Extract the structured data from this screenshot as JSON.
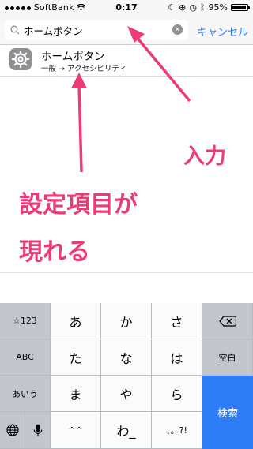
{
  "status_bar": {
    "carrier": "SoftBank",
    "time": "0:17",
    "battery_label": "95%",
    "battery_level": 0.95
  },
  "search": {
    "query": "ホームボタン",
    "cancel_label": "キャンセル"
  },
  "result": {
    "title": "ホームボタン",
    "path": "一般 → アクセシビリティ",
    "icon": "gear-icon"
  },
  "annotations": {
    "input_label": "入力",
    "appear_line1": "設定項目が",
    "appear_line2": "現れる",
    "color": "#ee3b76"
  },
  "keyboard": {
    "keys": {
      "numbers": "☆123",
      "abc": "ABC",
      "aiu": "あいう",
      "a": "あ",
      "ka": "か",
      "sa": "さ",
      "ta": "た",
      "na": "な",
      "ha": "は",
      "ma": "ま",
      "ya": "や",
      "ra": "ら",
      "dakuten": "^^",
      "wa": "わ_",
      "punct": "、。?!",
      "space": "空白",
      "search": "検索"
    },
    "accent_color": "#2e7cf6"
  }
}
